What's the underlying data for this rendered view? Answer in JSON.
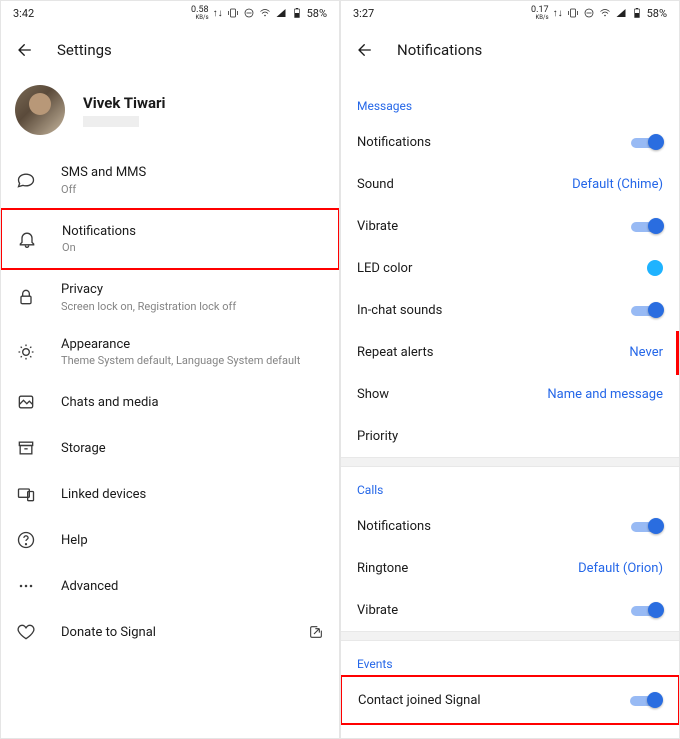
{
  "left": {
    "status": {
      "time": "3:42",
      "speed_top": "0.58",
      "speed_bot": "KB/s",
      "battery": "58%"
    },
    "header": {
      "title": "Settings"
    },
    "profile": {
      "name": "Vivek Tiwari"
    },
    "rows": {
      "sms": {
        "title": "SMS and MMS",
        "sub": "Off"
      },
      "notifications": {
        "title": "Notifications",
        "sub": "On"
      },
      "privacy": {
        "title": "Privacy",
        "sub": "Screen lock on, Registration lock off"
      },
      "appearance": {
        "title": "Appearance",
        "sub": "Theme System default, Language System default"
      },
      "chats": {
        "title": "Chats and media"
      },
      "storage": {
        "title": "Storage"
      },
      "linked": {
        "title": "Linked devices"
      },
      "help": {
        "title": "Help"
      },
      "advanced": {
        "title": "Advanced"
      },
      "donate": {
        "title": "Donate to Signal"
      }
    }
  },
  "right": {
    "status": {
      "time": "3:27",
      "speed_top": "0.17",
      "speed_bot": "KB/s",
      "battery": "58%"
    },
    "header": {
      "title": "Notifications"
    },
    "sections": {
      "messages": {
        "header": "Messages",
        "notifications": "Notifications",
        "sound": {
          "label": "Sound",
          "value": "Default (Chime)"
        },
        "vibrate": "Vibrate",
        "led": "LED color",
        "inchat": "In-chat sounds",
        "repeat": {
          "label": "Repeat alerts",
          "value": "Never"
        },
        "show": {
          "label": "Show",
          "value": "Name and message"
        },
        "priority": "Priority"
      },
      "calls": {
        "header": "Calls",
        "notifications": "Notifications",
        "ringtone": {
          "label": "Ringtone",
          "value": "Default (Orion)"
        },
        "vibrate": "Vibrate"
      },
      "events": {
        "header": "Events",
        "contact_joined": "Contact joined Signal"
      }
    }
  }
}
